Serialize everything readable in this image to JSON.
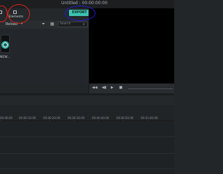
{
  "title": "Untitled : 00:00:00:00",
  "toolbar": {
    "items": [
      {
        "label": "Elements",
        "icon": "elements-icon"
      }
    ],
    "export_label": "EXPORT"
  },
  "media": {
    "filter_label": "Reload",
    "search_placeholder": "Search",
    "thumb_label": "NEW..."
  },
  "timeline": {
    "ticks": [
      "00:00:00",
      "00:00:10:00",
      "00:00:20:00",
      "00:00:30:00",
      "00:00:40:00",
      "00:00:50:00",
      "00:01:00:00"
    ]
  },
  "colors": {
    "accent": "#3ec4b0",
    "annotation_red": "#e0231a",
    "annotation_blue": "#2020d8"
  }
}
